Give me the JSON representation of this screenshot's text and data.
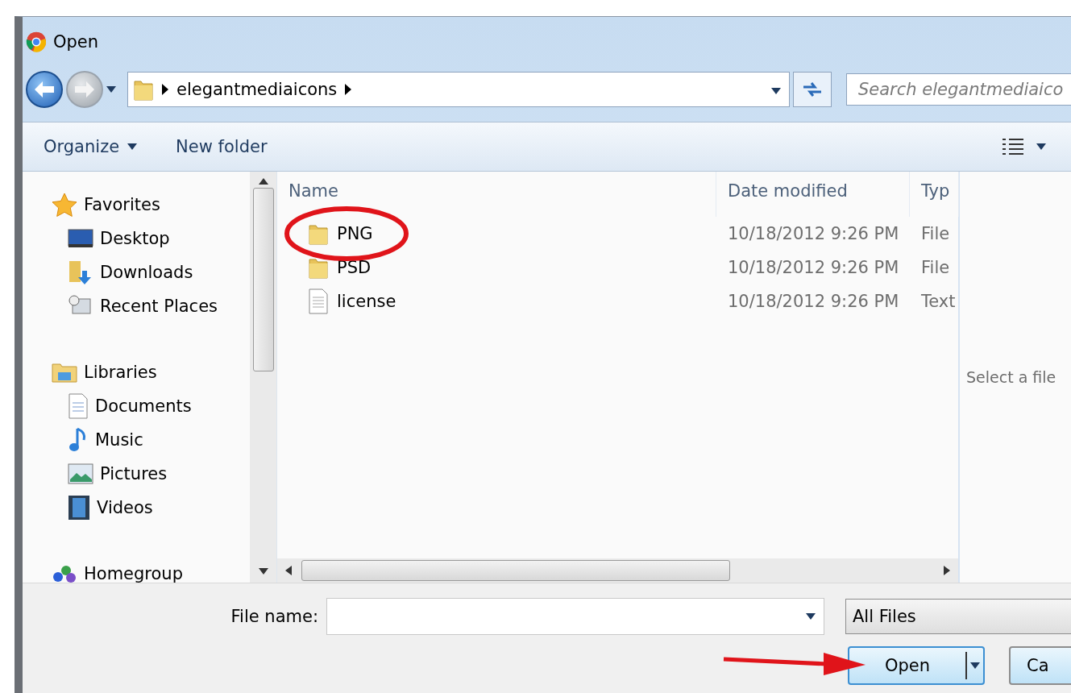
{
  "window": {
    "title": "Open"
  },
  "address_bar": {
    "path": [
      "elegantmediaicons"
    ]
  },
  "search": {
    "placeholder": "Search elegantmediaico"
  },
  "toolbar": [
    {
      "label": "Organize",
      "kind": "menu"
    },
    {
      "label": "New folder",
      "kind": "plain"
    }
  ],
  "nav": [
    {
      "label": "Favorites",
      "kind": "star",
      "children": [
        {
          "label": "Desktop",
          "kind": "desktop"
        },
        {
          "label": "Downloads",
          "kind": "downloads"
        },
        {
          "label": "Recent Places",
          "kind": "recent"
        }
      ]
    },
    {
      "label": "Libraries",
      "kind": "libraries",
      "children": [
        {
          "label": "Documents",
          "kind": "document"
        },
        {
          "label": "Music",
          "kind": "music"
        },
        {
          "label": "Pictures",
          "kind": "pictures"
        },
        {
          "label": "Videos",
          "kind": "videos"
        }
      ]
    },
    {
      "label": "Homegroup",
      "kind": "homegroup"
    }
  ],
  "columns": [
    "Name",
    "Date modified",
    "Typ"
  ],
  "files": [
    {
      "name": "PNG",
      "kind": "folder",
      "date": "10/18/2012 9:26 PM",
      "type": "File",
      "circled": true
    },
    {
      "name": "PSD",
      "kind": "folder",
      "date": "10/18/2012 9:26 PM",
      "type": "File",
      "circled": false
    },
    {
      "name": "license",
      "kind": "text",
      "date": "10/18/2012 9:26 PM",
      "type": "Text",
      "circled": false
    }
  ],
  "preview": "Select a file",
  "file_name": {
    "label": "File name:"
  },
  "filter": "All Files",
  "buttons": [
    {
      "label": "Open",
      "kind": "split",
      "pointed": true
    },
    {
      "label": "Ca",
      "kind": "plain",
      "pointed": false
    }
  ]
}
